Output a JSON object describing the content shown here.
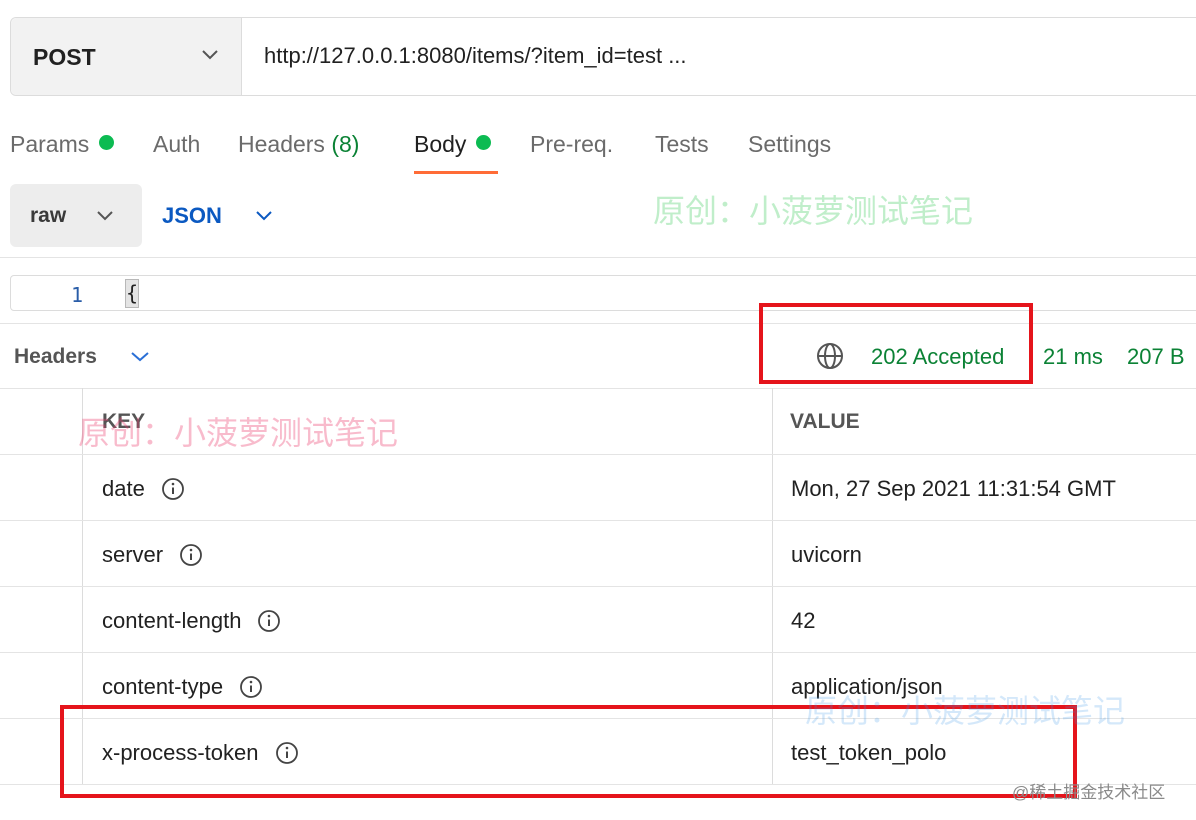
{
  "request": {
    "method": "POST",
    "url": "http://127.0.0.1:8080/items/?item_id=test ..."
  },
  "tabs": [
    {
      "label": "Params",
      "has_dot": true
    },
    {
      "label": "Auth"
    },
    {
      "label": "Headers",
      "count": "(8)"
    },
    {
      "label": "Body",
      "has_dot": true,
      "active": true
    },
    {
      "label": "Pre-req."
    },
    {
      "label": "Tests"
    },
    {
      "label": "Settings"
    }
  ],
  "body": {
    "mode": "raw",
    "language": "JSON",
    "editor": {
      "line_number": "1",
      "content": "{"
    }
  },
  "response": {
    "section_title": "Headers",
    "status": "202 Accepted",
    "time": "21 ms",
    "size": "207 B",
    "columns": {
      "key": "KEY",
      "value": "VALUE"
    },
    "headers": [
      {
        "key": "date",
        "value": "Mon, 27 Sep 2021 11:31:54 GMT"
      },
      {
        "key": "server",
        "value": "uvicorn"
      },
      {
        "key": "content-length",
        "value": "42"
      },
      {
        "key": "content-type",
        "value": "application/json"
      },
      {
        "key": "x-process-token",
        "value": "test_token_polo"
      }
    ]
  },
  "watermarks": {
    "text": "原创：小菠萝测试笔记",
    "site": "@稀土掘金技术社区"
  },
  "colors": {
    "accent_orange": "#ff6c37",
    "status_green": "#0b8235",
    "dot_green": "#0cbb52",
    "json_blue": "#0b59c1",
    "highlight_red": "#e5141b"
  }
}
